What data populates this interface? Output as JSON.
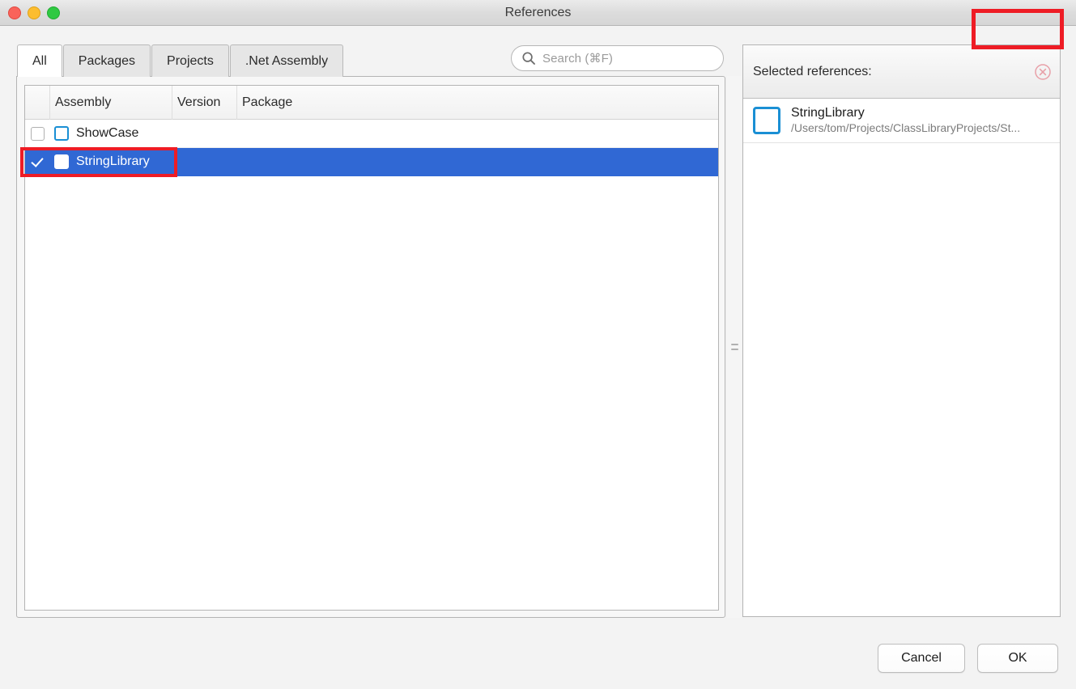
{
  "window": {
    "title": "References",
    "traffic_lights": [
      {
        "name": "close",
        "color": "#f9635a"
      },
      {
        "name": "minimize",
        "color": "#fcbd2f"
      },
      {
        "name": "maximize",
        "color": "#2fc942"
      }
    ]
  },
  "tabs": [
    {
      "label": "All",
      "active": true
    },
    {
      "label": "Packages",
      "active": false
    },
    {
      "label": "Projects",
      "active": false
    },
    {
      "label": ".Net Assembly",
      "active": false
    }
  ],
  "search": {
    "icon": "search-icon",
    "placeholder": "Search (⌘F)",
    "value": ""
  },
  "table": {
    "columns": [
      "",
      "Assembly",
      "Version",
      "Package"
    ],
    "rows": [
      {
        "checked": false,
        "selected": false,
        "assembly": "ShowCase",
        "version": "",
        "package": ""
      },
      {
        "checked": true,
        "selected": true,
        "assembly": "StringLibrary",
        "version": "",
        "package": ""
      }
    ]
  },
  "right_panel": {
    "title": "Selected references:",
    "clear_icon": "circle-x-icon",
    "items": [
      {
        "name": "StringLibrary",
        "path": "/Users/tom/Projects/ClassLibraryProjects/St..."
      }
    ]
  },
  "footer": {
    "cancel_label": "Cancel",
    "ok_label": "OK"
  },
  "annotations": {
    "highlight_color": "#ee1c25",
    "targets": [
      "stringlibrary-row",
      "ok-button"
    ]
  },
  "colors": {
    "selection_blue": "#3068d4",
    "assembly_icon_blue": "#1a8fd4",
    "clear_icon_pink": "#e8a0a8"
  }
}
